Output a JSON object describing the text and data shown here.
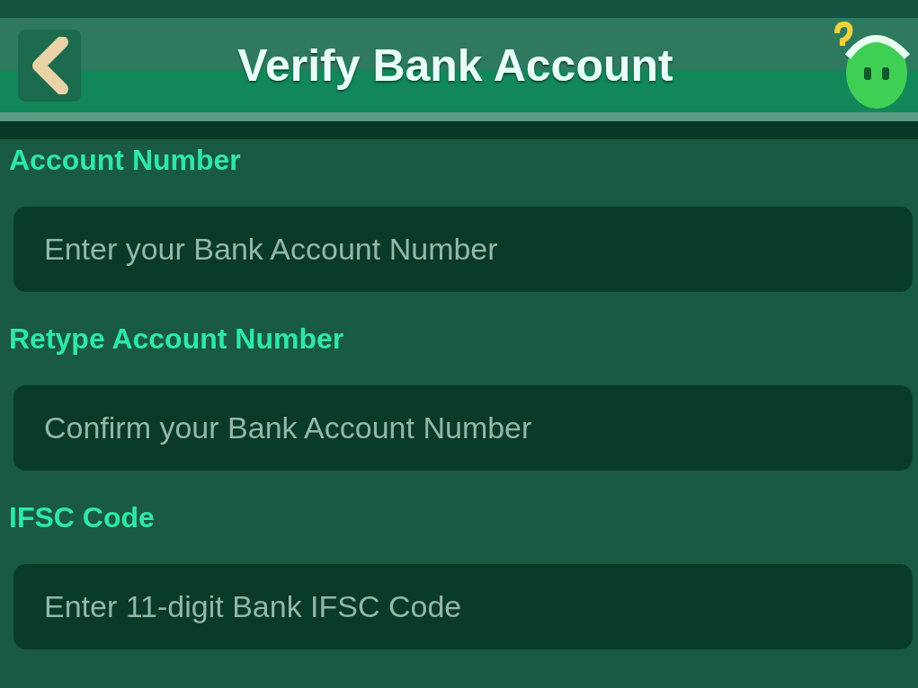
{
  "header": {
    "title": "Verify Bank Account"
  },
  "fields": [
    {
      "label": "Account Number",
      "placeholder": "Enter your Bank Account Number"
    },
    {
      "label": "Retype Account Number",
      "placeholder": "Confirm your Bank Account Number"
    },
    {
      "label": "IFSC Code",
      "placeholder": "Enter 11-digit Bank IFSC Code"
    }
  ]
}
